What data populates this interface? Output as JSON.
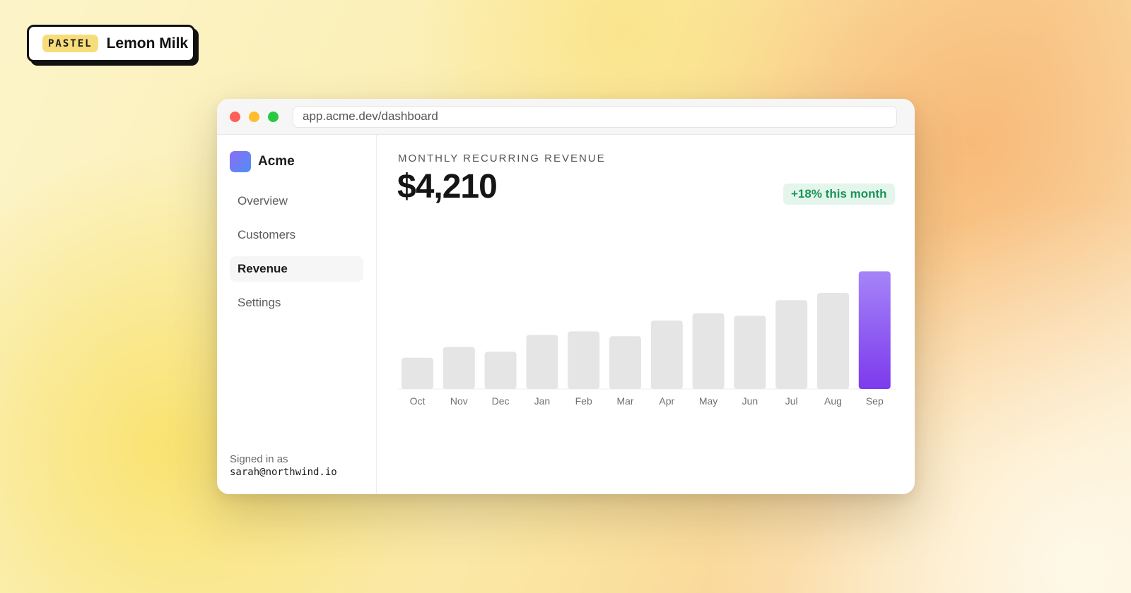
{
  "brand": {
    "badge": "PASTEL",
    "name": "Lemon Milk"
  },
  "browser": {
    "url": "app.acme.dev/dashboard"
  },
  "sidebar": {
    "app_name": "Acme",
    "items": [
      {
        "label": "Overview",
        "active": false
      },
      {
        "label": "Customers",
        "active": false
      },
      {
        "label": "Revenue",
        "active": true
      },
      {
        "label": "Settings",
        "active": false
      }
    ],
    "signed_in_label": "Signed in as",
    "signed_in_email": "sarah@northwind.io"
  },
  "metric": {
    "label": "MONTHLY RECURRING REVENUE",
    "value": "$4,210",
    "delta": "+18% this month"
  },
  "colors": {
    "accent": "#8b5cf6",
    "bar_inactive": "#e5e5e5",
    "delta_text": "#1c9457",
    "delta_bg": "#e4f6ec"
  },
  "chart_data": {
    "type": "bar",
    "categories": [
      "Oct",
      "Nov",
      "Dec",
      "Jan",
      "Feb",
      "Mar",
      "Apr",
      "May",
      "Jun",
      "Jul",
      "Aug",
      "Sep"
    ],
    "values": [
      26,
      35,
      31,
      45,
      48,
      44,
      57,
      63,
      61,
      74,
      80,
      98
    ],
    "highlight_index": 11,
    "ylim": [
      0,
      100
    ]
  }
}
